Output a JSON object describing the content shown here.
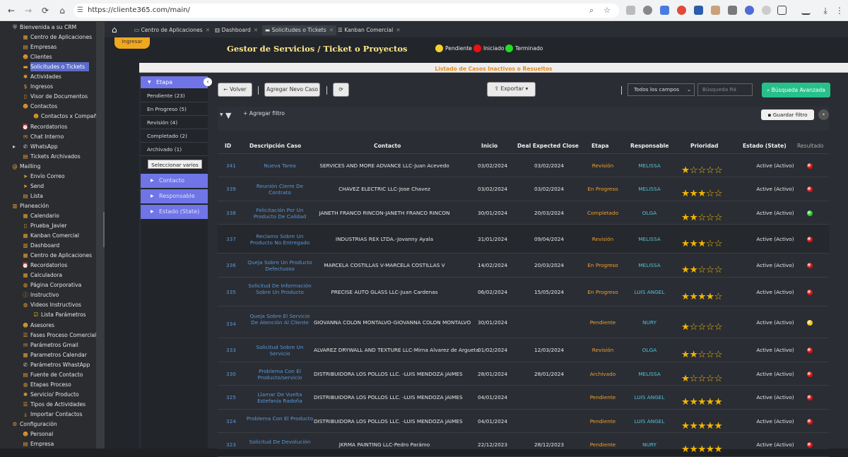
{
  "browser": {
    "url": "https://cliente365.com/main/"
  },
  "sidebar": {
    "items": [
      {
        "label": "Bienvenida a su CRM",
        "icon": "shield-icon"
      },
      {
        "label": "Centro de Aplicaciones",
        "icon": "app-icon"
      },
      {
        "label": "Empresas",
        "icon": "building-icon"
      },
      {
        "label": "Clientes",
        "icon": "users-icon"
      },
      {
        "label": "Solicitudes o Tickets",
        "icon": "ticket-icon"
      },
      {
        "label": "Actividades",
        "icon": "activity-icon"
      },
      {
        "label": "Ingresos",
        "icon": "dollar-icon"
      },
      {
        "label": "Visor de Documentos",
        "icon": "document-icon"
      },
      {
        "label": "Contactos",
        "icon": "contact-icon"
      },
      {
        "label": "Contactos x Compañía",
        "icon": "contact-icon"
      },
      {
        "label": "Recordatorios",
        "icon": "reminder-icon"
      },
      {
        "label": "Chat Interno",
        "icon": "chat-icon"
      },
      {
        "label": "WhatsApp",
        "icon": "whatsapp-icon"
      },
      {
        "label": "Tickets Archivados",
        "icon": "archive-icon"
      },
      {
        "label": "Mailling",
        "icon": "mail-icon"
      },
      {
        "label": "Envío Correo",
        "icon": "send-icon"
      },
      {
        "label": "Send",
        "icon": "send-icon"
      },
      {
        "label": "Lista",
        "icon": "list-icon"
      },
      {
        "label": "Planeación",
        "icon": "chart-icon"
      },
      {
        "label": "Calendario",
        "icon": "calendar-icon"
      },
      {
        "label": "Prueba_Javier",
        "icon": "page-icon"
      },
      {
        "label": "Kanban Comercial",
        "icon": "kanban-icon"
      },
      {
        "label": "Dashboard",
        "icon": "dashboard-icon"
      },
      {
        "label": "Centro de Aplicaciones",
        "icon": "app-icon"
      },
      {
        "label": "Recordatorios",
        "icon": "reminder-icon"
      },
      {
        "label": "Calculadora",
        "icon": "calculator-icon"
      },
      {
        "label": "Página Corporativa",
        "icon": "globe-icon"
      },
      {
        "label": "Instructivo",
        "icon": "info-icon"
      },
      {
        "label": "Videos Instructivos",
        "icon": "video-icon"
      },
      {
        "label": "Lista Parámetros",
        "icon": "checkbox-icon"
      },
      {
        "label": "Asesores",
        "icon": "users-icon"
      },
      {
        "label": "Fases Proceso Comercial",
        "icon": "phases-icon"
      },
      {
        "label": "Parámetros Gmail",
        "icon": "gmail-icon"
      },
      {
        "label": "Parametros Calendar",
        "icon": "calendar-icon"
      },
      {
        "label": "Parámetros WhastApp",
        "icon": "whatsapp-icon"
      },
      {
        "label": "Fuente de Contacto",
        "icon": "source-icon"
      },
      {
        "label": "Etapas Proceso",
        "icon": "stages-icon"
      },
      {
        "label": "Servicio/ Producto",
        "icon": "product-icon"
      },
      {
        "label": "Tipos de Actividades",
        "icon": "types-icon"
      },
      {
        "label": "Importar Contactos",
        "icon": "import-icon"
      },
      {
        "label": "Configuración",
        "icon": "gear-icon"
      },
      {
        "label": "Personal",
        "icon": "users-icon"
      },
      {
        "label": "Empresa",
        "icon": "building-icon"
      }
    ]
  },
  "tabs": [
    {
      "label": "Centro de Aplicaciones"
    },
    {
      "label": "Dashboard"
    },
    {
      "label": "Solicitudes o Tickets"
    },
    {
      "label": "Kanban Comercial"
    }
  ],
  "header": {
    "ingresar": "Ingresar",
    "title": "Gestor de Servicios / Ticket o Proyectos",
    "legend": [
      {
        "label": "Pendiente",
        "color": "#f5d12e"
      },
      {
        "label": "Iniciado",
        "color": "#ee1111"
      },
      {
        "label": "Terminado",
        "color": "#22dd22"
      }
    ]
  },
  "panel": {
    "title": "Listado de Casos Inactivos o Resueltos"
  },
  "filters": {
    "etapa_label": "Etapa",
    "options": [
      {
        "label": "Pendiente",
        "count": "(23)"
      },
      {
        "label": "En Progreso",
        "count": "(5)"
      },
      {
        "label": "Revisión",
        "count": "(4)"
      },
      {
        "label": "Completado",
        "count": "(2)"
      },
      {
        "label": "Archivado",
        "count": "(1)"
      }
    ],
    "select_multiple": "Seleccionar varios",
    "groups": [
      "Contacto",
      "Responsable",
      "Estado (State)"
    ]
  },
  "toolbar": {
    "back": "Volver",
    "add_case": "Agregar Nevo Caso",
    "export": "Exportar",
    "all_fields": "Todos los campos",
    "search_placeholder": "Búsqueda Rá",
    "advanced_search": "Búsqueda Avanzada",
    "add_filter": "Agregar filtro",
    "save_filter": "Guardar filtro"
  },
  "table": {
    "columns": [
      "ID",
      "Descripción Caso",
      "Contacto",
      "Inicio",
      "Deal Expected Close",
      "Etapa",
      "Responsable",
      "Prioridad",
      "Estado (State)",
      "Resultado"
    ],
    "rows": [
      {
        "id": "341",
        "desc": "Nueva Tarea",
        "contact": "SERVICES AND MORE ADVANCE LLC-Juan Acevedo",
        "start": "03/02/2024",
        "close": "03/02/2024",
        "etapa": "Revisión",
        "resp": "MELISSA",
        "prio": 1,
        "estado": "Active (Activo)",
        "result": "#dd1111"
      },
      {
        "id": "339",
        "desc": "Reunión Cierre De Contrato",
        "contact": "CHAVEZ ELECTRIC LLC-Jose Chavez",
        "start": "03/02/2024",
        "close": "03/02/2024",
        "etapa": "En Progreso",
        "resp": "MELISSA",
        "prio": 3,
        "estado": "Active (Activo)",
        "result": "#dd1111"
      },
      {
        "id": "338",
        "desc": "Felicitación Por Un Producto De Calidad",
        "contact": "JANETH FRANCO RINCON-JANETH FRANCO RINCON",
        "start": "30/01/2024",
        "close": "20/03/2024",
        "etapa": "Completado",
        "resp": "OLGA",
        "prio": 2,
        "estado": "Active (Activo)",
        "result": "#22cc22"
      },
      {
        "id": "337",
        "desc": "Reclamo Sobre Un Producto No Entregado",
        "contact": "INDUSTRIAS REX LTDA.-Jovanny Ayala",
        "start": "31/01/2024",
        "close": "09/04/2024",
        "etapa": "Revisión",
        "resp": "MELISSA",
        "prio": 3,
        "estado": "Active (Activo)",
        "result": "#dd1111"
      },
      {
        "id": "336",
        "desc": "Queja Sobre Un Producto Defectuoso",
        "contact": "MARCELA COSTILLAS V-MARCELA COSTILLAS V",
        "start": "14/02/2024",
        "close": "20/03/2024",
        "etapa": "En Progreso",
        "resp": "MELISSA",
        "prio": 2,
        "estado": "Active (Activo)",
        "result": "#dd1111"
      },
      {
        "id": "335",
        "desc": "Solicitud De Información Sobre Un Producto",
        "contact": "PRECISE AUTO GLASS LLC-Juan Cardenas",
        "start": "06/02/2024",
        "close": "15/05/2024",
        "etapa": "En Progreso",
        "resp": "LUIS ANGEL",
        "prio": 4,
        "estado": "Active (Activo)",
        "result": "#dd1111"
      },
      {
        "id": "334",
        "desc": "Queja Sobre El Servicio De Atención Al Cliente",
        "contact": "GIOVANNA COLON MONTALVO-GIOVANNA COLON MONTALVO",
        "start": "30/01/2024",
        "close": "",
        "etapa": "Pendiente",
        "resp": "NURY",
        "prio": 1,
        "estado": "Active (Activo)",
        "result": "#f2c414"
      },
      {
        "id": "333",
        "desc": "Solicitud Sobre Un Servicio",
        "contact": "ALVAREZ DRYWALL AND TEXTURE LLC-Mirna Alvarez de Argueta",
        "start": "01/02/2024",
        "close": "12/03/2024",
        "etapa": "Revisión",
        "resp": "OLGA",
        "prio": 2,
        "estado": "Active (Activo)",
        "result": "#dd1111"
      },
      {
        "id": "330",
        "desc": "Problema Con El Producto/servicio",
        "contact": "DISTRIBUIDORA LOS POLLOS LLC. -LUIS MENDOZA JAIMES",
        "start": "28/01/2024",
        "close": "28/01/2024",
        "etapa": "Archivado",
        "resp": "MELISSA",
        "prio": 1,
        "estado": "Active (Activo)",
        "result": "#dd1111"
      },
      {
        "id": "325",
        "desc": "Llamar De Vuelta Estefania Radoña",
        "contact": "DISTRIBUIDORA LOS POLLOS LLC. -LUIS MENDOZA JAIMES",
        "start": "04/01/2024",
        "close": "",
        "etapa": "Pendiente",
        "resp": "LUIS ANGEL",
        "prio": 5,
        "estado": "Active (Activo)",
        "result": "#dd1111"
      },
      {
        "id": "324",
        "desc": "Problema Con El Producto",
        "contact": "DISTRIBUIDORA LOS POLLOS LLC. -LUIS MENDOZA JAIMES",
        "start": "04/01/2024",
        "close": "",
        "etapa": "Pendiente",
        "resp": "LUIS ANGEL",
        "prio": 5,
        "estado": "Active (Activo)",
        "result": "#dd1111"
      },
      {
        "id": "323",
        "desc": "Solicitud De Devolución",
        "contact": "JKRMA PAINTING LLC-Pedro Parámo",
        "start": "22/12/2023",
        "close": "28/12/2023",
        "etapa": "Pendiente",
        "resp": "NURY",
        "prio": 5,
        "estado": "Active (Activo)",
        "result": "#dd1111"
      }
    ]
  }
}
